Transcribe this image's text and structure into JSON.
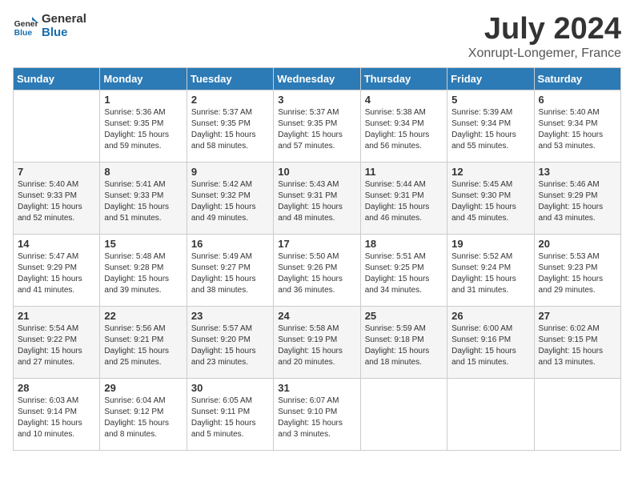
{
  "header": {
    "logo_general": "General",
    "logo_blue": "Blue",
    "title": "July 2024",
    "subtitle": "Xonrupt-Longemer, France"
  },
  "calendar": {
    "days_of_week": [
      "Sunday",
      "Monday",
      "Tuesday",
      "Wednesday",
      "Thursday",
      "Friday",
      "Saturday"
    ],
    "weeks": [
      [
        {
          "day": "",
          "info": ""
        },
        {
          "day": "1",
          "info": "Sunrise: 5:36 AM\nSunset: 9:35 PM\nDaylight: 15 hours\nand 59 minutes."
        },
        {
          "day": "2",
          "info": "Sunrise: 5:37 AM\nSunset: 9:35 PM\nDaylight: 15 hours\nand 58 minutes."
        },
        {
          "day": "3",
          "info": "Sunrise: 5:37 AM\nSunset: 9:35 PM\nDaylight: 15 hours\nand 57 minutes."
        },
        {
          "day": "4",
          "info": "Sunrise: 5:38 AM\nSunset: 9:34 PM\nDaylight: 15 hours\nand 56 minutes."
        },
        {
          "day": "5",
          "info": "Sunrise: 5:39 AM\nSunset: 9:34 PM\nDaylight: 15 hours\nand 55 minutes."
        },
        {
          "day": "6",
          "info": "Sunrise: 5:40 AM\nSunset: 9:34 PM\nDaylight: 15 hours\nand 53 minutes."
        }
      ],
      [
        {
          "day": "7",
          "info": "Sunrise: 5:40 AM\nSunset: 9:33 PM\nDaylight: 15 hours\nand 52 minutes."
        },
        {
          "day": "8",
          "info": "Sunrise: 5:41 AM\nSunset: 9:33 PM\nDaylight: 15 hours\nand 51 minutes."
        },
        {
          "day": "9",
          "info": "Sunrise: 5:42 AM\nSunset: 9:32 PM\nDaylight: 15 hours\nand 49 minutes."
        },
        {
          "day": "10",
          "info": "Sunrise: 5:43 AM\nSunset: 9:31 PM\nDaylight: 15 hours\nand 48 minutes."
        },
        {
          "day": "11",
          "info": "Sunrise: 5:44 AM\nSunset: 9:31 PM\nDaylight: 15 hours\nand 46 minutes."
        },
        {
          "day": "12",
          "info": "Sunrise: 5:45 AM\nSunset: 9:30 PM\nDaylight: 15 hours\nand 45 minutes."
        },
        {
          "day": "13",
          "info": "Sunrise: 5:46 AM\nSunset: 9:29 PM\nDaylight: 15 hours\nand 43 minutes."
        }
      ],
      [
        {
          "day": "14",
          "info": "Sunrise: 5:47 AM\nSunset: 9:29 PM\nDaylight: 15 hours\nand 41 minutes."
        },
        {
          "day": "15",
          "info": "Sunrise: 5:48 AM\nSunset: 9:28 PM\nDaylight: 15 hours\nand 39 minutes."
        },
        {
          "day": "16",
          "info": "Sunrise: 5:49 AM\nSunset: 9:27 PM\nDaylight: 15 hours\nand 38 minutes."
        },
        {
          "day": "17",
          "info": "Sunrise: 5:50 AM\nSunset: 9:26 PM\nDaylight: 15 hours\nand 36 minutes."
        },
        {
          "day": "18",
          "info": "Sunrise: 5:51 AM\nSunset: 9:25 PM\nDaylight: 15 hours\nand 34 minutes."
        },
        {
          "day": "19",
          "info": "Sunrise: 5:52 AM\nSunset: 9:24 PM\nDaylight: 15 hours\nand 31 minutes."
        },
        {
          "day": "20",
          "info": "Sunrise: 5:53 AM\nSunset: 9:23 PM\nDaylight: 15 hours\nand 29 minutes."
        }
      ],
      [
        {
          "day": "21",
          "info": "Sunrise: 5:54 AM\nSunset: 9:22 PM\nDaylight: 15 hours\nand 27 minutes."
        },
        {
          "day": "22",
          "info": "Sunrise: 5:56 AM\nSunset: 9:21 PM\nDaylight: 15 hours\nand 25 minutes."
        },
        {
          "day": "23",
          "info": "Sunrise: 5:57 AM\nSunset: 9:20 PM\nDaylight: 15 hours\nand 23 minutes."
        },
        {
          "day": "24",
          "info": "Sunrise: 5:58 AM\nSunset: 9:19 PM\nDaylight: 15 hours\nand 20 minutes."
        },
        {
          "day": "25",
          "info": "Sunrise: 5:59 AM\nSunset: 9:18 PM\nDaylight: 15 hours\nand 18 minutes."
        },
        {
          "day": "26",
          "info": "Sunrise: 6:00 AM\nSunset: 9:16 PM\nDaylight: 15 hours\nand 15 minutes."
        },
        {
          "day": "27",
          "info": "Sunrise: 6:02 AM\nSunset: 9:15 PM\nDaylight: 15 hours\nand 13 minutes."
        }
      ],
      [
        {
          "day": "28",
          "info": "Sunrise: 6:03 AM\nSunset: 9:14 PM\nDaylight: 15 hours\nand 10 minutes."
        },
        {
          "day": "29",
          "info": "Sunrise: 6:04 AM\nSunset: 9:12 PM\nDaylight: 15 hours\nand 8 minutes."
        },
        {
          "day": "30",
          "info": "Sunrise: 6:05 AM\nSunset: 9:11 PM\nDaylight: 15 hours\nand 5 minutes."
        },
        {
          "day": "31",
          "info": "Sunrise: 6:07 AM\nSunset: 9:10 PM\nDaylight: 15 hours\nand 3 minutes."
        },
        {
          "day": "",
          "info": ""
        },
        {
          "day": "",
          "info": ""
        },
        {
          "day": "",
          "info": ""
        }
      ]
    ]
  }
}
